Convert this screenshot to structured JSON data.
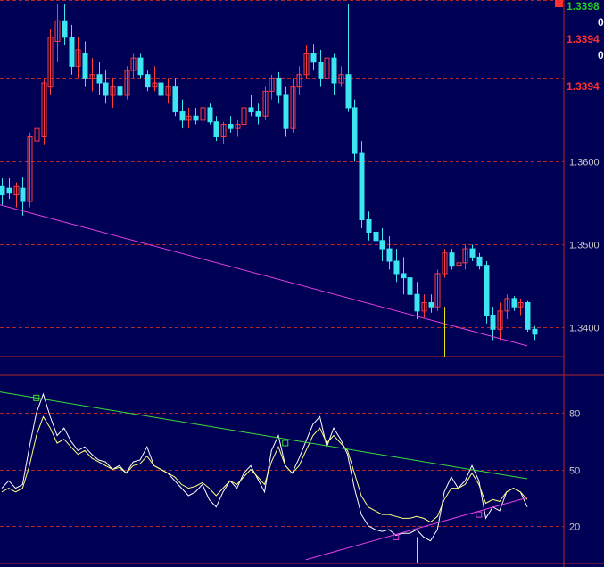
{
  "colors": {
    "background": "#000055",
    "grid": "#b02828",
    "frame": "#b02828",
    "bull": "#ff3c3c",
    "bear": "#3ce6f0",
    "trend_magenta": "#e040e0",
    "trend_green": "#3cdc3c",
    "osc_white": "#ffffff",
    "osc_yellow": "#ffff80",
    "marker_yellow": "#e8e800",
    "tag_green": "#22cc22",
    "tag_red": "#ff3030",
    "tag_white": "#ffffff",
    "axis_text": "#c8c8c8"
  },
  "price_tags": [
    {
      "text": "1.3398",
      "color": "green"
    },
    {
      "text": "0",
      "color": "white"
    },
    {
      "text": "1.3394",
      "color": "red"
    },
    {
      "text": "0",
      "color": "white"
    },
    {
      "text": "1.3394",
      "color": "red"
    }
  ],
  "chart_data": [
    {
      "type": "candlestick",
      "title": "",
      "ylim": [
        1.3365,
        1.3795
      ],
      "y_ticks": [
        "1.3400",
        "1.3500",
        "1.3600"
      ],
      "grid": true,
      "candles": [
        [
          1.357,
          1.358,
          1.3548,
          1.356
        ],
        [
          1.3568,
          1.358,
          1.3555,
          1.3562
        ],
        [
          1.356,
          1.3575,
          1.3545,
          1.357
        ],
        [
          1.3568,
          1.3582,
          1.3535,
          1.3552
        ],
        [
          1.3552,
          1.3635,
          1.3545,
          1.363
        ],
        [
          1.3625,
          1.366,
          1.361,
          1.364
        ],
        [
          1.363,
          1.37,
          1.362,
          1.3695
        ],
        [
          1.369,
          1.376,
          1.368,
          1.375
        ],
        [
          1.3745,
          1.379,
          1.372,
          1.377
        ],
        [
          1.377,
          1.379,
          1.374,
          1.375
        ],
        [
          1.375,
          1.3765,
          1.3705,
          1.3715
        ],
        [
          1.3715,
          1.375,
          1.37,
          1.3735
        ],
        [
          1.373,
          1.3745,
          1.369,
          1.37
        ],
        [
          1.37,
          1.3725,
          1.3685,
          1.3705
        ],
        [
          1.3705,
          1.372,
          1.368,
          1.3695
        ],
        [
          1.3695,
          1.371,
          1.367,
          1.368
        ],
        [
          1.368,
          1.37,
          1.3665,
          1.369
        ],
        [
          1.369,
          1.3705,
          1.367,
          1.368
        ],
        [
          1.368,
          1.3715,
          1.3675,
          1.371
        ],
        [
          1.371,
          1.373,
          1.37,
          1.3725
        ],
        [
          1.3725,
          1.373,
          1.37,
          1.3705
        ],
        [
          1.3705,
          1.371,
          1.3685,
          1.369
        ],
        [
          1.369,
          1.3715,
          1.3685,
          1.3695
        ],
        [
          1.3695,
          1.3705,
          1.3675,
          1.368
        ],
        [
          1.368,
          1.37,
          1.367,
          1.369
        ],
        [
          1.369,
          1.37,
          1.3655,
          1.366
        ],
        [
          1.366,
          1.3675,
          1.364,
          1.365
        ],
        [
          1.365,
          1.3665,
          1.364,
          1.3655
        ],
        [
          1.3655,
          1.3665,
          1.3645,
          1.365
        ],
        [
          1.365,
          1.367,
          1.364,
          1.3665
        ],
        [
          1.3665,
          1.367,
          1.3645,
          1.3648
        ],
        [
          1.3648,
          1.3655,
          1.3625,
          1.363
        ],
        [
          1.363,
          1.3648,
          1.3622,
          1.3645
        ],
        [
          1.3645,
          1.3655,
          1.3635,
          1.364
        ],
        [
          1.364,
          1.365,
          1.363,
          1.3645
        ],
        [
          1.3645,
          1.367,
          1.364,
          1.3665
        ],
        [
          1.3665,
          1.368,
          1.3655,
          1.366
        ],
        [
          1.366,
          1.367,
          1.3645,
          1.3655
        ],
        [
          1.3655,
          1.369,
          1.365,
          1.3685
        ],
        [
          1.3685,
          1.3705,
          1.3675,
          1.37
        ],
        [
          1.37,
          1.3708,
          1.367,
          1.368
        ],
        [
          1.368,
          1.369,
          1.363,
          1.364
        ],
        [
          1.364,
          1.37,
          1.3635,
          1.369
        ],
        [
          1.369,
          1.3715,
          1.368,
          1.3705
        ],
        [
          1.3705,
          1.374,
          1.37,
          1.373
        ],
        [
          1.373,
          1.3742,
          1.371,
          1.372
        ],
        [
          1.372,
          1.3735,
          1.369,
          1.37
        ],
        [
          1.37,
          1.3728,
          1.3695,
          1.3725
        ],
        [
          1.3725,
          1.373,
          1.368,
          1.3695
        ],
        [
          1.3695,
          1.3715,
          1.369,
          1.3705
        ],
        [
          1.3705,
          1.379,
          1.366,
          1.3665
        ],
        [
          1.3665,
          1.3675,
          1.36,
          1.361
        ],
        [
          1.361,
          1.3625,
          1.352,
          1.353
        ],
        [
          1.353,
          1.354,
          1.3505,
          1.3515
        ],
        [
          1.3515,
          1.3525,
          1.349,
          1.3505
        ],
        [
          1.3505,
          1.352,
          1.348,
          1.3495
        ],
        [
          1.3495,
          1.351,
          1.347,
          1.348
        ],
        [
          1.348,
          1.3495,
          1.3455,
          1.3465
        ],
        [
          1.3465,
          1.3485,
          1.344,
          1.346
        ],
        [
          1.346,
          1.3475,
          1.3425,
          1.344
        ],
        [
          1.344,
          1.3455,
          1.341,
          1.342
        ],
        [
          1.342,
          1.344,
          1.3412,
          1.343
        ],
        [
          1.343,
          1.344,
          1.3418,
          1.3425
        ],
        [
          1.3425,
          1.347,
          1.342,
          1.3465
        ],
        [
          1.3465,
          1.3495,
          1.346,
          1.349
        ],
        [
          1.349,
          1.3495,
          1.347,
          1.3475
        ],
        [
          1.3475,
          1.3485,
          1.3465,
          1.3478
        ],
        [
          1.3478,
          1.35,
          1.347,
          1.3495
        ],
        [
          1.3495,
          1.35,
          1.348,
          1.3485
        ],
        [
          1.3485,
          1.349,
          1.347,
          1.3475
        ],
        [
          1.3475,
          1.348,
          1.3405,
          1.3415
        ],
        [
          1.3415,
          1.3425,
          1.3385,
          1.3398
        ],
        [
          1.3398,
          1.343,
          1.3385,
          1.342
        ],
        [
          1.342,
          1.344,
          1.341,
          1.3435
        ],
        [
          1.3435,
          1.3438,
          1.342,
          1.3425
        ],
        [
          1.3425,
          1.3435,
          1.3415,
          1.343
        ],
        [
          1.343,
          1.3432,
          1.3395,
          1.3398
        ],
        [
          1.3398,
          1.3402,
          1.3385,
          1.3392
        ]
      ],
      "trendline": {
        "from": [
          0,
          1.3548
        ],
        "to": [
          76,
          1.3378
        ]
      },
      "vertical_marker_index": 64
    },
    {
      "type": "line",
      "title": "",
      "ylim": [
        0,
        100
      ],
      "y_ticks": [
        "20",
        "50",
        "80"
      ],
      "grid": true,
      "series": [
        {
          "color_key": "osc_white",
          "values": [
            40,
            44,
            40,
            42,
            62,
            80,
            90,
            78,
            68,
            72,
            65,
            60,
            62,
            58,
            55,
            54,
            50,
            52,
            48,
            54,
            55,
            62,
            52,
            50,
            48,
            44,
            40,
            36,
            38,
            42,
            34,
            30,
            38,
            44,
            40,
            48,
            52,
            45,
            38,
            60,
            68,
            52,
            48,
            56,
            65,
            74,
            78,
            62,
            72,
            66,
            58,
            40,
            26,
            20,
            18,
            17,
            18,
            15,
            16,
            16,
            18,
            14,
            12,
            18,
            38,
            46,
            40,
            44,
            52,
            44,
            24,
            30,
            28,
            38,
            40,
            38,
            30
          ]
        },
        {
          "color_key": "osc_yellow",
          "values": [
            38,
            40,
            38,
            40,
            52,
            68,
            78,
            72,
            64,
            66,
            62,
            58,
            60,
            56,
            54,
            52,
            50,
            51,
            48,
            52,
            53,
            57,
            52,
            50,
            48,
            46,
            42,
            40,
            41,
            43,
            40,
            36,
            40,
            44,
            42,
            46,
            50,
            46,
            42,
            54,
            62,
            52,
            48,
            52,
            60,
            68,
            72,
            64,
            68,
            64,
            60,
            48,
            36,
            30,
            28,
            26,
            26,
            25,
            24,
            24,
            25,
            24,
            22,
            25,
            34,
            40,
            40,
            42,
            48,
            42,
            32,
            34,
            33,
            38,
            40,
            38,
            34
          ]
        }
      ],
      "trendline_green": {
        "from": [
          5,
          88
        ],
        "to": [
          76,
          45
        ]
      },
      "trendline_magenta": {
        "from": [
          44,
          2
        ],
        "to": [
          76,
          35
        ]
      },
      "markers": [
        {
          "index": 5,
          "value": 88,
          "color_key": "trend_green"
        },
        {
          "index": 41,
          "value": 64,
          "color_key": "trend_green"
        },
        {
          "index": 57,
          "value": 14,
          "color_key": "trend_magenta"
        },
        {
          "index": 69,
          "value": 26,
          "color_key": "trend_magenta"
        }
      ],
      "vertical_marker_index": 60
    }
  ]
}
